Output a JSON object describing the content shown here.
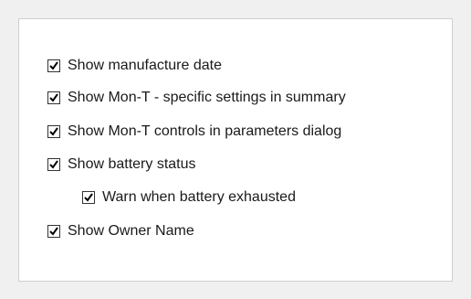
{
  "options": [
    {
      "label": "Show manufacture date",
      "checked": true
    },
    {
      "label": "Show Mon-T - specific settings in summary",
      "checked": true
    },
    {
      "label": "Show Mon-T controls in parameters dialog",
      "checked": true
    },
    {
      "label": "Show battery status",
      "checked": true
    },
    {
      "label": "Warn when battery exhausted",
      "checked": true
    },
    {
      "label": "Show Owner Name",
      "checked": true
    }
  ],
  "icons": {
    "check": "checkmark-icon"
  },
  "colors": {
    "panel_background": "#f0f0f0",
    "group_background": "#ffffff",
    "group_border": "#cfcfcf",
    "checkbox_border": "#333333",
    "check_color": "#000000",
    "text": "#1a1a1a"
  }
}
